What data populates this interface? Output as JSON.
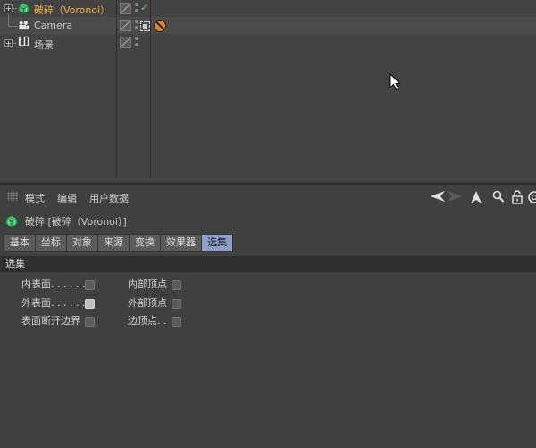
{
  "object_manager": {
    "objects": [
      {
        "label": "破碎（Voronoi）",
        "icon": "voronoi-fracture-icon",
        "active": true
      },
      {
        "label": "Camera",
        "icon": "camera-icon"
      },
      {
        "label": "场景",
        "icon": "null-object-icon"
      }
    ],
    "check_mark": "✓"
  },
  "attribute_manager": {
    "menu": [
      "模式",
      "编辑",
      "用户数据"
    ],
    "title": "破碎 [破碎（Voronoi）]",
    "tabs": [
      "基本",
      "坐标",
      "对象",
      "来源",
      "变换",
      "效果器",
      "选集"
    ],
    "active_tab": "选集",
    "section_title": "选集",
    "options_left": [
      {
        "label": "内表面. . . . . .",
        "checked": false
      },
      {
        "label": "外表面. . . . . .",
        "checked": true
      },
      {
        "label": "表面断开边界",
        "checked": false
      }
    ],
    "options_right": [
      {
        "label": "内部顶点",
        "checked": false
      },
      {
        "label": "外部顶点",
        "checked": false
      },
      {
        "label": "边顶点. .",
        "checked": false
      }
    ]
  },
  "colors": {
    "active_object": "#f2b63c",
    "active_tab": "#8aa0c8",
    "check_green": "#5fcf5f"
  }
}
